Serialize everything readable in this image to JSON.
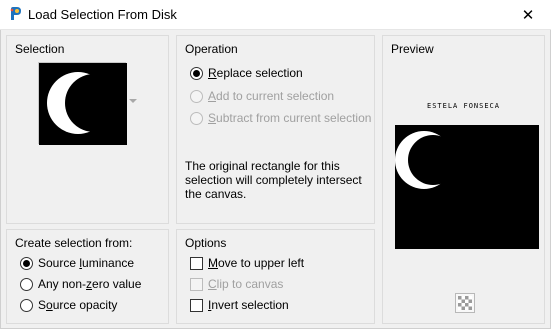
{
  "window": {
    "title": "Load Selection From Disk",
    "close_glyph": "✕"
  },
  "selection_group": {
    "title": "Selection"
  },
  "operation_group": {
    "title": "Operation",
    "options": [
      {
        "pre": "",
        "u": "R",
        "post": "eplace selection",
        "checked": true,
        "enabled": true
      },
      {
        "pre": "",
        "u": "A",
        "post": "dd to current selection",
        "checked": false,
        "enabled": false
      },
      {
        "pre": "",
        "u": "S",
        "post": "ubtract from current selection",
        "checked": false,
        "enabled": false
      }
    ],
    "note": "The original rectangle for this selection will completely intersect the canvas."
  },
  "preview_group": {
    "title": "Preview",
    "caption": "ESTELA FONSECA"
  },
  "create_group": {
    "title": "Create selection from:",
    "options": [
      {
        "pre": "Source ",
        "u": "l",
        "post": "uminance",
        "checked": true
      },
      {
        "pre": "Any non-",
        "u": "z",
        "post": "ero value",
        "checked": false
      },
      {
        "pre": "S",
        "u": "o",
        "post": "urce opacity",
        "checked": false
      }
    ]
  },
  "options_group": {
    "title": "Options",
    "options": [
      {
        "pre": "",
        "u": "M",
        "post": "ove to upper left",
        "checked": false,
        "enabled": true
      },
      {
        "pre": "",
        "u": "C",
        "post": "lip to canvas",
        "checked": false,
        "enabled": false
      },
      {
        "pre": "",
        "u": "I",
        "post": "nvert selection",
        "checked": false,
        "enabled": true
      }
    ]
  },
  "icons": {
    "app": "paintshop-app-icon",
    "close": "close-icon",
    "dropdown": "chevron-down-icon",
    "transparency": "checkerboard-icon"
  },
  "colors": {
    "accent_blue": "#1e73be",
    "selection_black": "#000000",
    "selection_white": "#ffffff",
    "disabled_text": "#a0a0a0"
  }
}
